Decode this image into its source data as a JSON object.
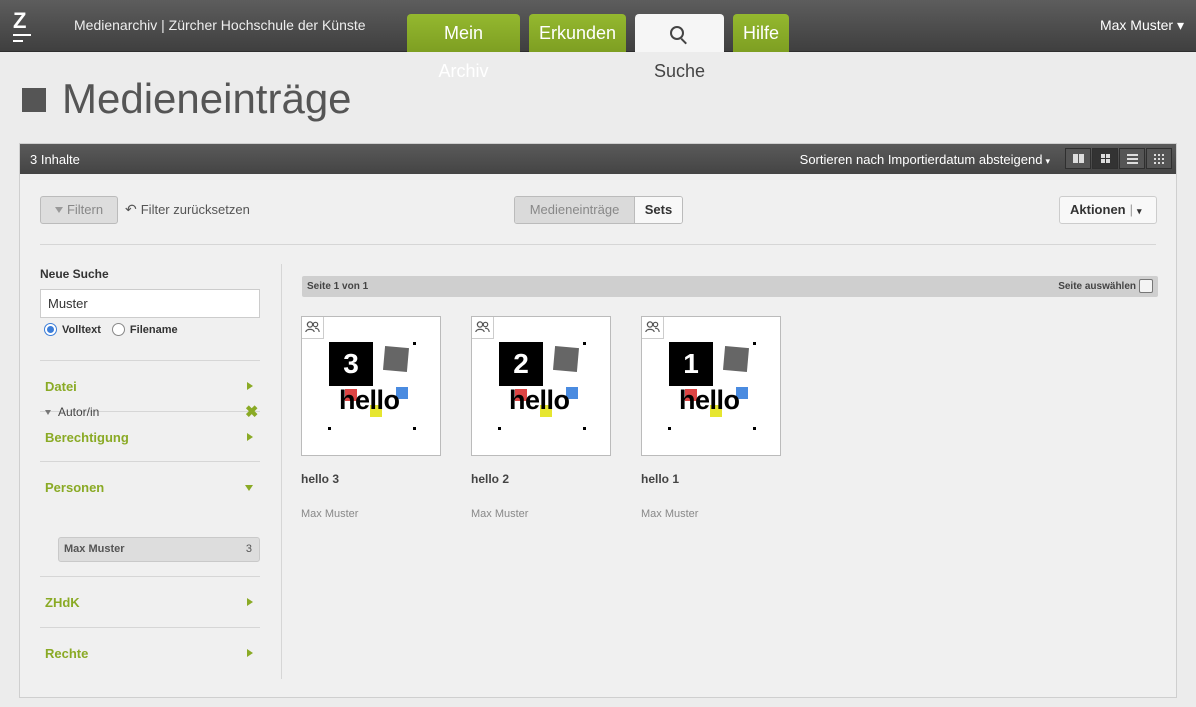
{
  "app": {
    "logo_letter": "Z",
    "title": "Medienarchiv | Zürcher Hochschule der Künste"
  },
  "nav": {
    "tabs": [
      {
        "label": "Mein Archiv",
        "active": false
      },
      {
        "label": "Erkunden",
        "active": false
      },
      {
        "label": "Suche",
        "active": true,
        "icon": "search-icon"
      },
      {
        "label": "Hilfe",
        "active": false
      }
    ],
    "user": "Max Muster",
    "user_caret": "▾"
  },
  "page": {
    "title": "Medieneinträge"
  },
  "toolbar": {
    "count": "3 Inhalte",
    "sort_label": "Sortieren nach Importierdatum absteigend",
    "sort_caret": "▾",
    "views": [
      "tiles-large-icon",
      "grid-icon",
      "list-icon",
      "miniature-icon"
    ],
    "active_view": "grid-icon",
    "filter_label": "Filtern",
    "reset_label": "Filter zurücksetzen",
    "type_tabs": [
      "Medieneinträge",
      "Sets"
    ],
    "actions_label": "Aktionen",
    "actions_caret": "▾"
  },
  "sidebar": {
    "new_search_label": "Neue Suche",
    "search_value": "Muster",
    "radio_fulltext": "Volltext",
    "radio_filename": "Filename",
    "facets": [
      {
        "label": "Datei",
        "expanded": false
      },
      {
        "label": "Berechtigung",
        "expanded": false
      },
      {
        "label": "Personen",
        "expanded": true
      },
      {
        "label": "ZHdK",
        "expanded": false
      },
      {
        "label": "Rechte",
        "expanded": false
      }
    ],
    "sub_facet_label": "Autor/in",
    "sub_facet_remove": "✖",
    "value_pill": {
      "label": "Max Muster",
      "count": "3"
    }
  },
  "results": {
    "page_label": "Seite 1 von 1",
    "select_page_label": "Seite auswählen",
    "items": [
      {
        "number": "3",
        "hello": "hello",
        "title": "hello 3",
        "author": "Max Muster"
      },
      {
        "number": "2",
        "hello": "hello",
        "title": "hello 2",
        "author": "Max Muster"
      },
      {
        "number": "1",
        "hello": "hello",
        "title": "hello 1",
        "author": "Max Muster"
      }
    ]
  },
  "colors": {
    "accent_green": "#8aaa25",
    "tab_green": "#94b82f",
    "topbar_dark": "#4a4a4a"
  }
}
